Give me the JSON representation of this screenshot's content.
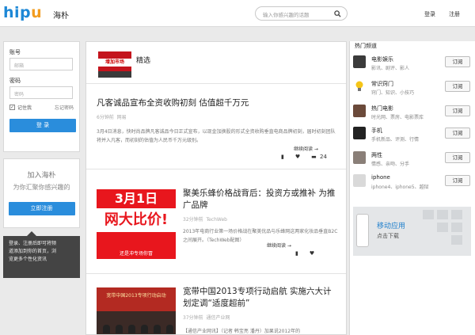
{
  "header": {
    "logo_part1": "hip",
    "logo_part2": "u",
    "brand": "海朴",
    "search_placeholder": "输入你感兴趣的话题",
    "login": "登录",
    "register": "注册"
  },
  "login_panel": {
    "account_label": "账号",
    "account_placeholder": "邮箱",
    "password_label": "密码",
    "password_placeholder": "密码",
    "remember_label": "记住我",
    "forgot_label": "忘记密码",
    "login_button": "登 录"
  },
  "join_panel": {
    "title": "加入海朴",
    "subtitle": "为你汇聚你感兴趣的",
    "button": "立即注册"
  },
  "tooltip": {
    "line1": "登录、注册后即可将频",
    "line2": "道添加到你的首页，浏",
    "line3": "览更多个性化资讯"
  },
  "featured": {
    "label": "精选",
    "thumb_text": "增加市场"
  },
  "articles": [
    {
      "title": "凡客诚品宣布全资收购初刻 估值超千万元",
      "time": "6分钟前",
      "source": "网易",
      "body": "3月4日消息，快时尚品牌凡客诚品今日正式宣布，以现金加换股的形式全资收购垂直电商品牌初刻，届时初刻团队将并入凡客，而初刻的估值为人民币千万元级别。",
      "read_more": "继续阅读 →",
      "comment_count": "24"
    },
    {
      "title": "聚美乐蜂价格战背后：投资方或推补 为推广品牌",
      "time": "32分钟前",
      "source": "TechWeb",
      "body": "2013年电商行业第一场价格战在聚美优品与乐蜂网这两家化妆品垂直B2C之间展开。（TechWeb配图）",
      "read_more": "继续阅读 →",
      "image_top": "3月1日",
      "image_mid": "网大比价!",
      "image_bottom": "还是冲专场你冒"
    },
    {
      "title": "宽带中国2013专项行动启航 实施六大计划定调“适度超前”",
      "time": "37分钟前",
      "source": "通信产业网",
      "body": "【通信产业网讯】（记者 韩宝亮 潘丹）加果说2012年的",
      "image_banner": "宽带中国2013专项行动启动"
    }
  ],
  "right_panel": {
    "heading": "热门频道",
    "subscribe_label": "订阅",
    "channels": [
      {
        "name": "电影娱乐",
        "tags": "影讯、剧评、影人"
      },
      {
        "name": "常识窍门",
        "tags": "窍门、知识、小技巧"
      },
      {
        "name": "热门电影",
        "tags": "时光网、票房、电影票库"
      },
      {
        "name": "手机",
        "tags": "手机新品、评测、行情"
      },
      {
        "name": "两性",
        "tags": "情感、亲吻、分手"
      },
      {
        "name": "iphone",
        "tags": "iphone4、iphone5、越狱"
      }
    ],
    "mobile_title": "移动应用",
    "mobile_sub": "点击下载"
  },
  "colors": {
    "brand_blue": "#1e88d6",
    "brand_orange": "#f29c1f",
    "button_blue": "#2a8ddc"
  }
}
